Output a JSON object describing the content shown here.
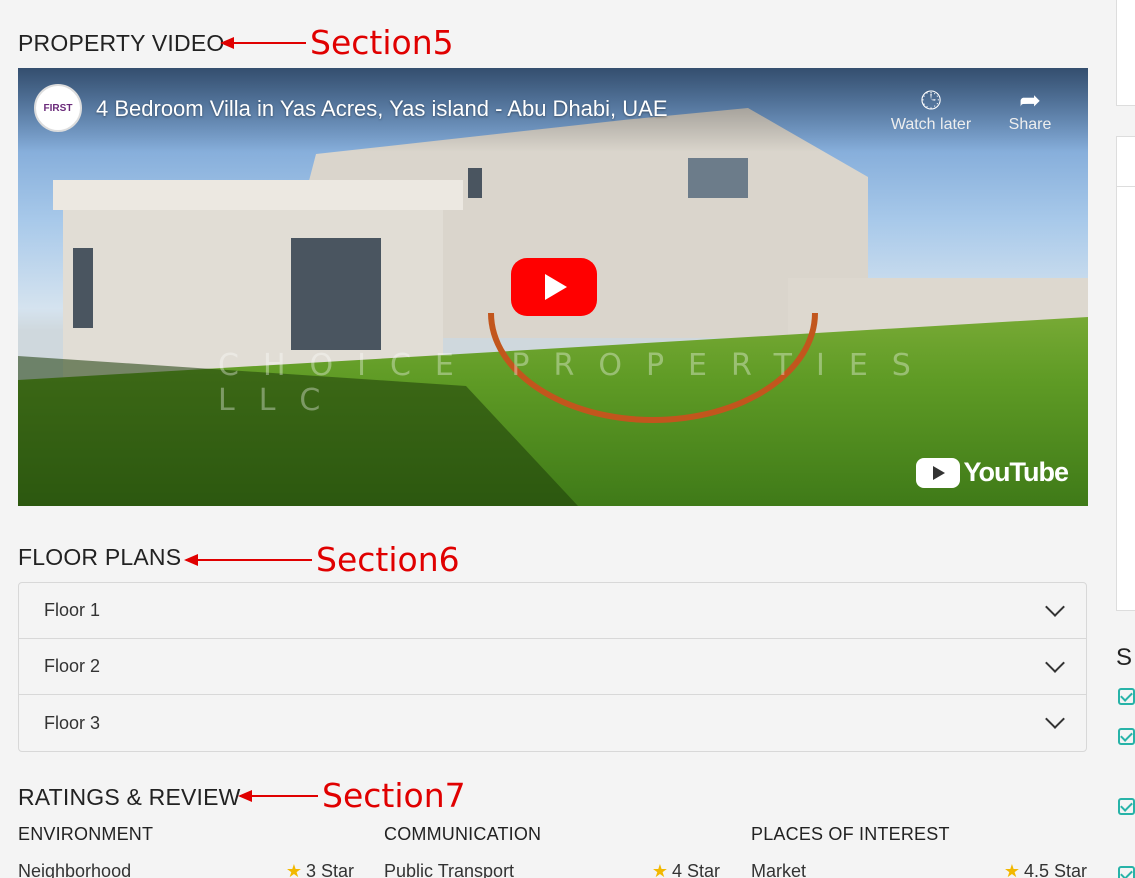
{
  "sections": {
    "video": {
      "title": "PROPERTY VIDEO",
      "annotation": "Section5"
    },
    "floor_plans": {
      "title": "FLOOR PLANS",
      "annotation": "Section6"
    },
    "ratings": {
      "title": "RATINGS & REVIEW",
      "annotation": "Section7"
    }
  },
  "video": {
    "title": "4 Bedroom Villa in Yas Acres, Yas island - Abu Dhabi, UAE",
    "channel_logo_text": "FIRST",
    "watch_later": "Watch later",
    "share": "Share",
    "watermark": "CHOICE PROPERTIES LLC",
    "youtube_label": "YouTube"
  },
  "floors": [
    "Floor 1",
    "Floor 2",
    "Floor 3"
  ],
  "ratings": [
    {
      "heading": "ENVIRONMENT",
      "item": "Neighborhood",
      "value": "3 Star"
    },
    {
      "heading": "COMMUNICATION",
      "item": "Public Transport",
      "value": "4 Star"
    },
    {
      "heading": "PLACES OF INTEREST",
      "item": "Market",
      "value": "4.5 Star"
    }
  ],
  "side_panel": {
    "heading_fragment": "S"
  },
  "colors": {
    "annotation": "#e00000",
    "star": "#f2b800",
    "check": "#27b3a8",
    "play": "#ff0000"
  }
}
